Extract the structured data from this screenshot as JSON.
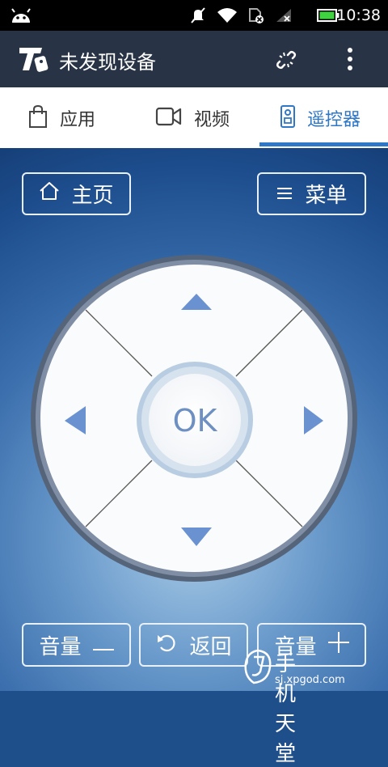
{
  "status_bar": {
    "time": "10:38"
  },
  "action_bar": {
    "title": "未发现设备"
  },
  "tabs": [
    {
      "label": "应用",
      "icon": "bag-icon"
    },
    {
      "label": "视频",
      "icon": "video-camera-icon"
    },
    {
      "label": "遥控器",
      "icon": "remote-icon",
      "active": true
    }
  ],
  "remote": {
    "home_label": "主页",
    "menu_label": "菜单",
    "ok_label": "OK",
    "volume_down_label": "音量",
    "back_label": "返回",
    "volume_up_label": "音量"
  },
  "watermark": {
    "text": "手机天堂",
    "url": "sj.xpgod.com"
  },
  "colors": {
    "accent": "#2f78c8",
    "actionbar": "#283446",
    "arrow": "#6b92d0"
  }
}
